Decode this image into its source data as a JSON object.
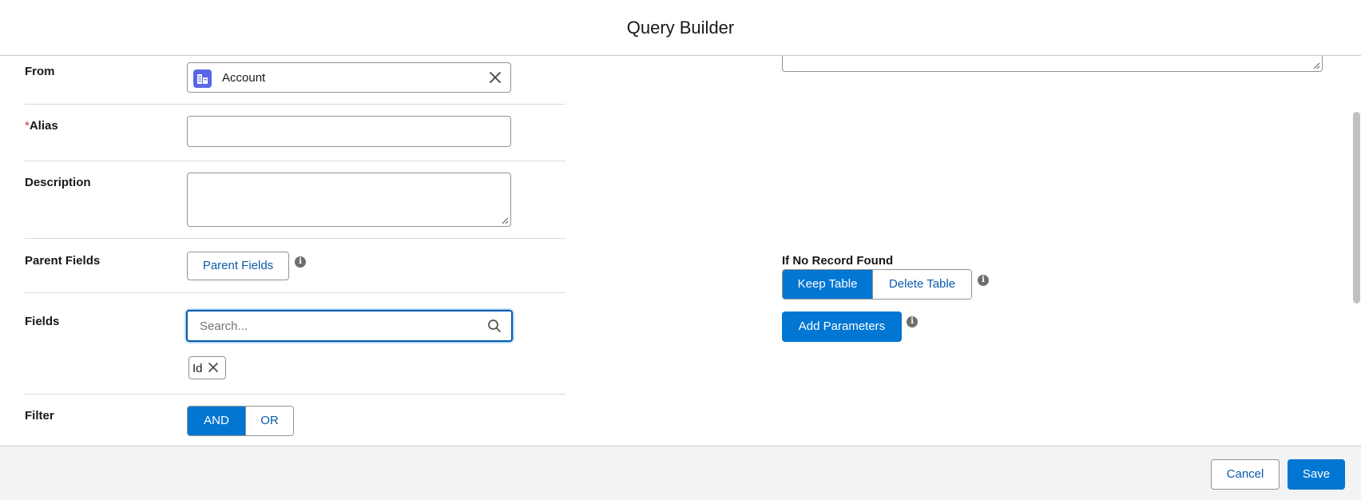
{
  "modal": {
    "title": "Query Builder"
  },
  "form": {
    "from": {
      "label": "From",
      "value": "Account",
      "object_icon": "account-object-icon",
      "clear_icon": "close-icon"
    },
    "alias": {
      "required_mark": "*",
      "label": "Alias",
      "value": ""
    },
    "description": {
      "label": "Description",
      "value": ""
    },
    "parent_fields": {
      "label": "Parent Fields",
      "button_label": "Parent Fields",
      "info_icon": "info-icon"
    },
    "fields": {
      "label": "Fields",
      "search_placeholder": "Search...",
      "search_value": "",
      "search_icon": "search-icon",
      "selected": [
        {
          "label": "Id",
          "remove_icon": "close-icon"
        }
      ]
    },
    "filter": {
      "label": "Filter",
      "options": [
        "AND",
        "OR"
      ],
      "selected": "AND"
    }
  },
  "right_panel": {
    "top_textarea_value": "",
    "if_no_record_found": {
      "label": "If No Record Found",
      "options": [
        "Keep Table",
        "Delete Table"
      ],
      "selected": "Keep Table",
      "info_icon": "info-icon"
    },
    "add_parameters": {
      "button_label": "Add Parameters",
      "info_icon": "info-icon"
    }
  },
  "footer": {
    "cancel_label": "Cancel",
    "save_label": "Save"
  },
  "colors": {
    "brand": "#0176d3",
    "link": "#0b5cab",
    "account_icon": "#5867e8",
    "required": "#c23934",
    "footer_bg": "#f3f3f3"
  }
}
